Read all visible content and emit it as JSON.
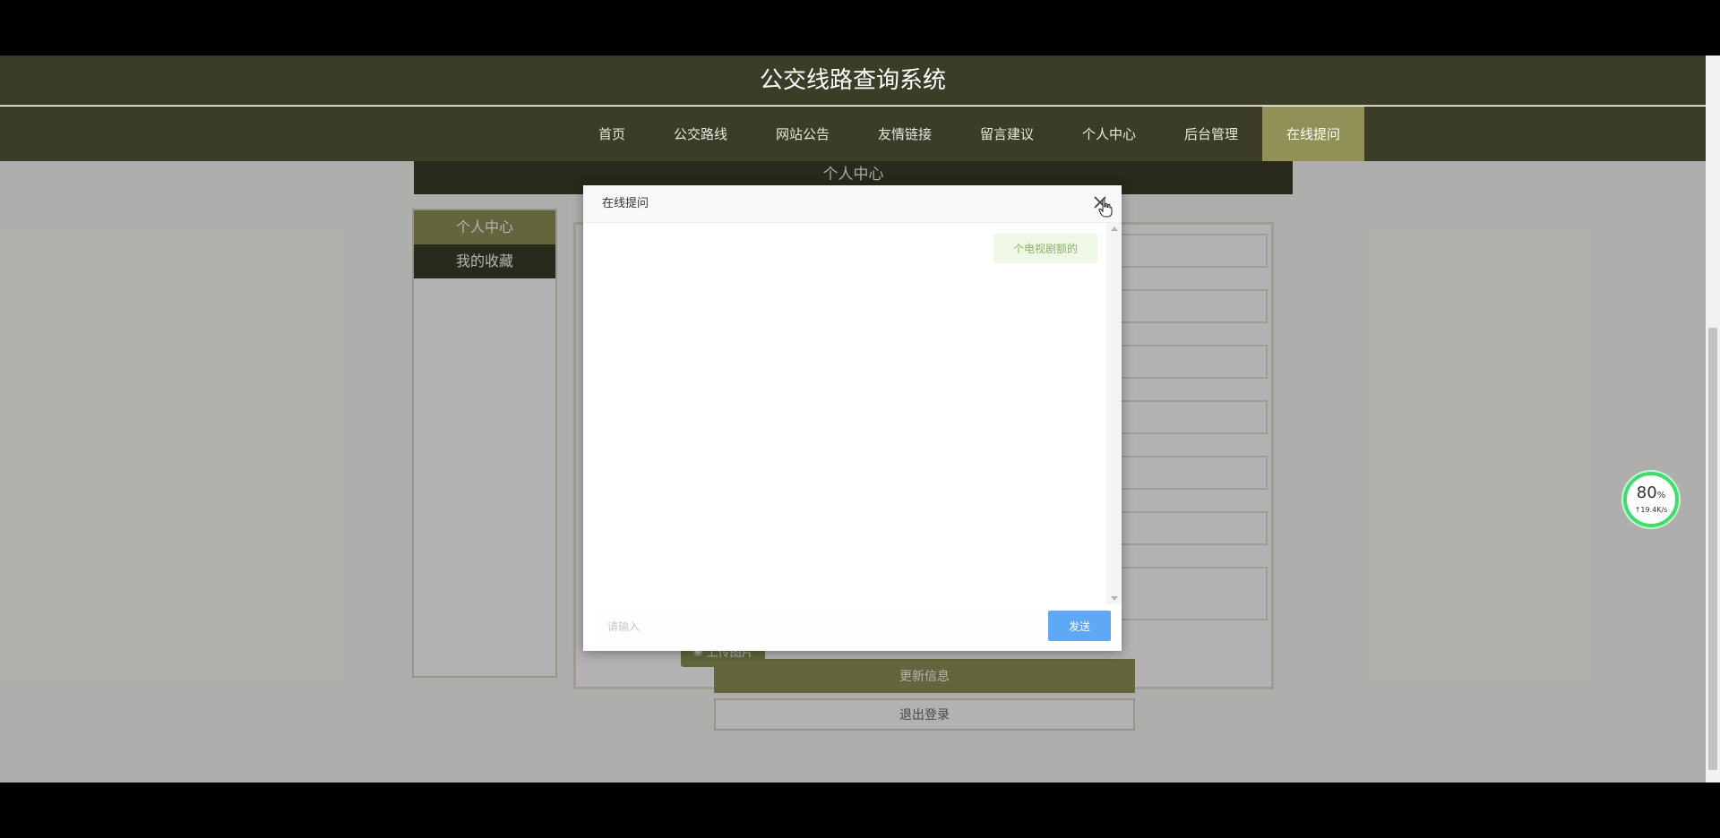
{
  "site": {
    "title": "公交线路查询系统"
  },
  "nav": {
    "items": [
      {
        "label": "首页"
      },
      {
        "label": "公交路线"
      },
      {
        "label": "网站公告"
      },
      {
        "label": "友情链接"
      },
      {
        "label": "留言建议"
      },
      {
        "label": "个人中心"
      },
      {
        "label": "后台管理"
      },
      {
        "label": "在线提问"
      }
    ],
    "active_index": 7
  },
  "section": {
    "title": "个人中心"
  },
  "left_menu": {
    "items": [
      {
        "label": "个人中心"
      },
      {
        "label": "我的收藏"
      }
    ]
  },
  "form": {
    "upload_label": "上传图片",
    "update_label": "更新信息",
    "logout_label": "退出登录"
  },
  "dialog": {
    "title": "在线提问",
    "messages": [
      {
        "text": "个电视剧额的"
      }
    ],
    "input_placeholder": "请输入",
    "send_label": "发送"
  },
  "speed_widget": {
    "percent": "80",
    "percent_unit": "%",
    "rate": "↑19.4K/s"
  },
  "colors": {
    "header_bg": "#3b3d29",
    "accent": "#8f9157",
    "send_button": "#5fa8f5"
  }
}
